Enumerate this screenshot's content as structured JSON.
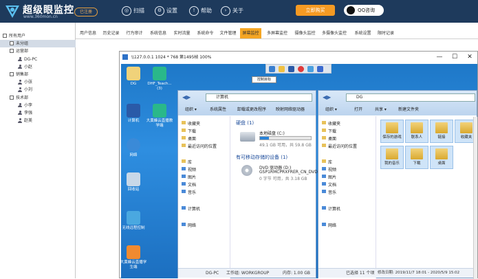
{
  "header": {
    "logo_title": "超级眼监控",
    "logo_url": "www.360mon.cn",
    "login_label": "已注册",
    "nav": [
      "扫描",
      "设置",
      "帮助",
      "关于"
    ],
    "buy_label": "立即购买",
    "qq_label": "QQ咨询",
    "colors": {
      "header_bg": "#1e3a5c",
      "buy": "#f59a23"
    }
  },
  "sidebar": {
    "tree": [
      {
        "label": "所有用户",
        "level": 0,
        "type": "box"
      },
      {
        "label": "未分组",
        "level": 1,
        "type": "box",
        "selected": true
      },
      {
        "label": "运营部",
        "level": 1,
        "type": "box"
      },
      {
        "label": "DG-PC",
        "level": 2,
        "type": "user"
      },
      {
        "label": "小赵",
        "level": 2,
        "type": "user"
      },
      {
        "label": "销售部",
        "level": 1,
        "type": "box"
      },
      {
        "label": "小张",
        "level": 2,
        "type": "user"
      },
      {
        "label": "小刘",
        "level": 2,
        "type": "user"
      },
      {
        "label": "技术部",
        "level": 1,
        "type": "box"
      },
      {
        "label": "小李",
        "level": 2,
        "type": "user"
      },
      {
        "label": "李强",
        "level": 2,
        "type": "user"
      },
      {
        "label": "赵美",
        "level": 2,
        "type": "user"
      }
    ]
  },
  "tabs": {
    "items": [
      "用户信息",
      "历史记录",
      "行为审计",
      "系统信息",
      "实时流量",
      "系统命令",
      "文件管理",
      "屏幕监控",
      "多屏幕监控",
      "摄像头监控",
      "多摄像头监控",
      "系统设置",
      "限时记录"
    ],
    "active": "屏幕监控"
  },
  "viewer": {
    "title": "\\\\127.0.0.1 1024 * 768 第1495帧 100%",
    "tooltip": "控制目标",
    "window_controls": [
      "—",
      "☐",
      "✕"
    ],
    "desktop_icons": [
      "DG",
      "DHF_Teach...(3)",
      "计算机",
      "大黄蜂云直播教学端",
      "网络",
      "回收站",
      "无线远程控制",
      "大黄蜂云直播学生端"
    ],
    "explorer_left": {
      "address": "计算机",
      "commands": [
        "组织 ▾",
        "系统属性",
        "卸载或更改程序",
        "映射网络驱动器"
      ],
      "nav": {
        "favorites": "收藏夹",
        "downloads": "下载",
        "desktop": "桌面",
        "recent": "最近访问的位置",
        "libraries": "库",
        "videos": "视频",
        "pictures": "图片",
        "docs": "文档",
        "music": "音乐",
        "computer": "计算机",
        "network": "网络"
      },
      "hdd_section": "硬盘 (1)",
      "removable_section": "有可移动存储的设备 (1)",
      "drive_c_name": "本地磁盘 (C:)",
      "drive_c_info": "49.1 GB 可用，共 59.8 GB",
      "drive_c_used": 0.18,
      "dvd_name": "DVD 驱动器 (D:)",
      "dvd_label": "GSP1RMCPRXFRER_CN_DVD",
      "dvd_info": "0 字节 可用，共 3.18 GB",
      "status_left": "DG-PC",
      "status_mid": "工作组: WORKGROUP",
      "status_right": "内存: 1.00 GB"
    },
    "explorer_right": {
      "address": "DG",
      "commands": [
        "组织 ▾",
        "打开",
        "共享 ▾",
        "新建文件夹"
      ],
      "nav": {
        "favorites": "收藏夹",
        "downloads": "下载",
        "desktop": "桌面",
        "recent": "最近访问的位置",
        "libraries": "库",
        "videos": "视频",
        "pictures": "图片",
        "docs": "文档",
        "music": "音乐",
        "computer": "计算机",
        "network": "网络"
      },
      "folders": [
        "保存的游戏",
        "联系人",
        "链接",
        "收藏夹",
        "我的音乐",
        "下载",
        "桌面"
      ],
      "status": "已选择 11 个项",
      "status_date": "修改日期: 2019/11/7 18:01 - 2020/5/9 15:02"
    }
  }
}
